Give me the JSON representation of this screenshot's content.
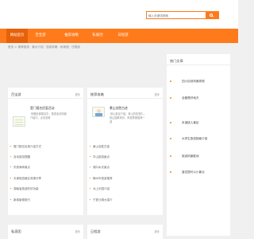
{
  "search": {
    "placeholder": "输入关键词搜索"
  },
  "nav": [
    {
      "label": "网站首页"
    },
    {
      "label": "百宝游"
    },
    {
      "label": "推荐攻略"
    },
    {
      "label": "私家团"
    },
    {
      "label": "日程游"
    }
  ],
  "breadcrumb": "首页 > 推荐旅游 · 景点介绍 · 旅游攻略 · 私家团 · 日程游",
  "left_panel": {
    "title": "百宝游",
    "more": "更多",
    "featured": {
      "title": "登门报名优惠活动",
      "desc": "·攻略全部报名中，旅游活动详细介绍中，点击查看"
    },
    "items": [
      "登门报名优惠介绍方式",
      "自动旅游提醒",
      "东莞海岸景点",
      "天津旅游景区资源分享",
      "湖南省旅游的好功能",
      "新城景德旅行"
    ]
  },
  "middle_panel": {
    "title": "推荐攻略",
    "more": "更多",
    "featured": {
      "title": "景山名胜古迹",
      "desc": "·景山景区介绍，景山历史悠久，景山园林风光，风景秀美值得一游"
    },
    "items": [
      "景山名胜古迹",
      "华山旅游景点",
      "湖口水天景点",
      "梅州市旅游推荐",
      "冰上乐园介绍",
      "宁夏沙湖大漠介"
    ]
  },
  "right_panel": {
    "title": "热门文章",
    "items": [
      "四川自然风景秀丽",
      "全都是好地方",
      "本溪桃人景区",
      "大学生旅游指南介绍",
      "旅游风景胜地",
      "蓝花园可以小景点"
    ]
  },
  "bottom_panels": [
    {
      "title": "私家团",
      "more": "更多"
    },
    {
      "title": "日程游",
      "more": "更多"
    }
  ],
  "colors": {
    "accent": "#ff7a1a",
    "active": "#e86109",
    "panel": "#ffffff",
    "background": "#f0f0f0"
  },
  "icons": {
    "search": "search-icon",
    "bullet": "bullet-icon"
  }
}
